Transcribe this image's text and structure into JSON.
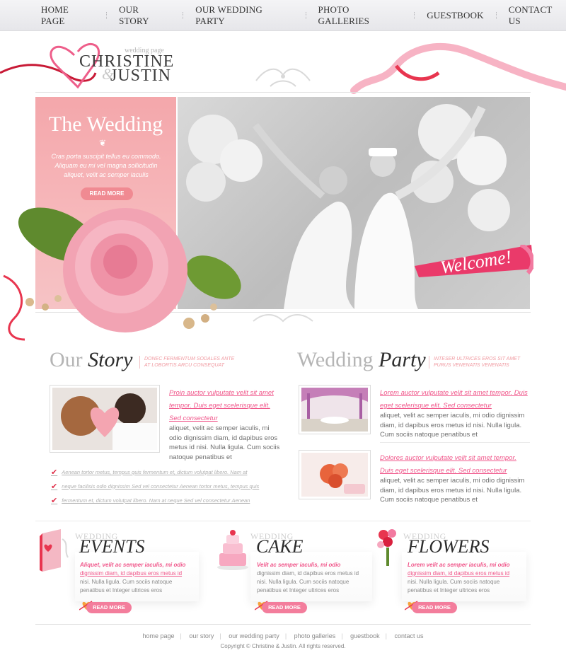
{
  "nav": {
    "items": [
      "HOME PAGE",
      "OUR STORY",
      "OUR WEDDING PARTY",
      "PHOTO GALLERIES",
      "GUESTBOOK",
      "CONTACT US"
    ]
  },
  "logo": {
    "sub": "wedding page",
    "name1": "CHRISTINE",
    "amp": "&",
    "name2": "JUSTIN"
  },
  "hero": {
    "title": "The Wedding",
    "ornament": "❦",
    "text": "Cras porta suscipit tellus eu commodo. Aliquam eu mi vel magna sollicitudin aliquet, velit ac semper iaculis",
    "button": "READ MORE",
    "welcome": "Welcome!"
  },
  "story": {
    "title_light": "Our",
    "title_bold": "Story",
    "tagline1": "DONEC FERMENTUM SODALES ANTE",
    "tagline2": "AT LOBORTIS ARCU CONSEQUAT",
    "link": "Proin auctor vulputate velit sit amet tempor. Duis eget scelerisque elit. Sed consectetur",
    "text": "aliquet, velit ac semper iaculis, mi odio dignissim diam, id dapibus eros metus id nisi. Nulla ligula. Cum sociis natoque penatibus et",
    "checklist": [
      "Aenean tortor metus, tempus quis fermentum et, dictum volutpat libero. Nam at",
      "neque facilisis odio dignissim Sed vel consectetur Aenean tortor metus, tempus quis",
      "fermentum et, dictum volutpat libero. Nam at neque Sed vel consectetur Aenean"
    ]
  },
  "party": {
    "title_light": "Wedding",
    "title_bold": "Party",
    "tagline1": "INTESER ULTRICES EROS SIT AMET",
    "tagline2": "PURUS VENENATIS VENENATIS",
    "item1_link": "Lorem auctor vulputate velit sit amet tempor. Duis eget scelerisque elit. Sed consectetur",
    "item1_text": "aliquet, velit ac semper iaculis, mi odio dignissim diam, id dapibus eros metus id nisi. Nulla ligula. Cum sociis natoque penatibus et",
    "item2_link": "Dolores auctor vulputate velit sit amet tempor. Duis eget scelerisque elit. Sed consectetur",
    "item2_text": "aliquet, velit ac semper iaculis, mi odio dignissim diam, id dapibus eros metus id nisi. Nulla ligula. Cum sociis natoque penatibus et"
  },
  "features": [
    {
      "kicker": "WEDDING",
      "head": "EVENTS",
      "t1": "Aliquet, velit ac semper iaculis, mi odio",
      "t2": "dignissim diam, id dapibus eros metus id",
      "t3": "nisi. Nulla ligula. Cum sociis natoque penatibus et Integer ultrices eros",
      "more": "READ MORE"
    },
    {
      "kicker": "WEDDING",
      "head": "CAKE",
      "t1": "Velit ac semper iaculis, mi odio",
      "t2": "dignissim diam, id dapibus eros metus id",
      "t3": "nisi. Nulla ligula. Cum sociis natoque penatibus et Integer ultrices eros",
      "more": "READ MORE"
    },
    {
      "kicker": "WEDDING",
      "head": "FLOWERS",
      "t1": "Lorem velit ac semper iaculis, mi odio",
      "t2": "dignissim diam, id dapibus eros metus id",
      "t3": "nisi. Nulla ligula. Cum sociis natoque penatibus et Integer ultrices eros",
      "more": "READ MORE"
    }
  ],
  "footer": {
    "items": [
      "home page",
      "our story",
      "our wedding party",
      "photo galleries",
      "guestbook",
      "contact us"
    ],
    "copyright": "Copyright © Christine & Justin. All rights reserved."
  },
  "colors": {
    "accent": "#f0568a",
    "hero_pink": "#f4a7ab",
    "ribbon": "#e8354f"
  }
}
